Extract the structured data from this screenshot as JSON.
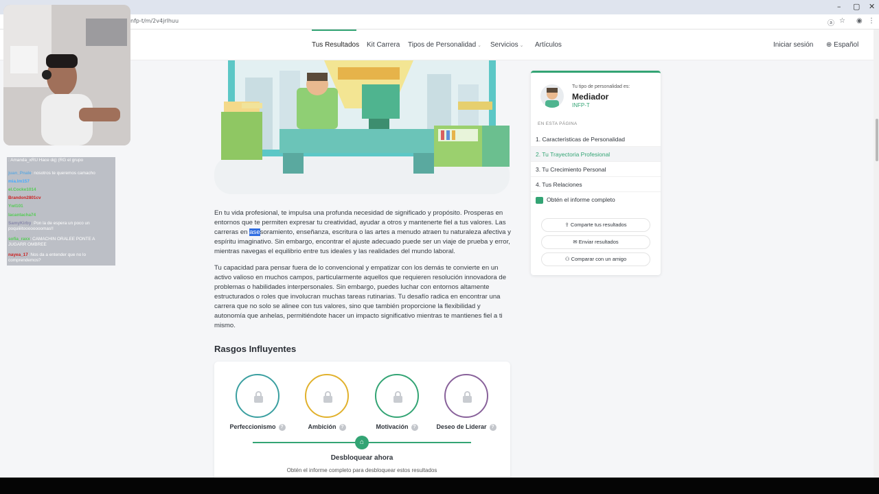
{
  "browser": {
    "url": "nfp-t/m/2v4jrlhuu",
    "window_controls": [
      "–",
      "▢",
      "✕"
    ]
  },
  "nav": {
    "items": [
      {
        "label": "Tus Resultados",
        "chevron": ""
      },
      {
        "label": "Kit Carrera",
        "chevron": ""
      },
      {
        "label": "Tipos de Personalidad",
        "chevron": "⌄"
      },
      {
        "label": "Servicios",
        "chevron": "⌄"
      },
      {
        "label": "Artículos",
        "chevron": ""
      }
    ],
    "login": "Iniciar sesión",
    "language": "Español"
  },
  "content": {
    "para1_a": "En tu vida profesional, te impulsa una profunda necesidad de significado y propósito. Prosperas en entornos que te permiten expresar tu creatividad, ayudar a otros y mantenerte fiel a tus valores. Las carreras en ",
    "para1_hl": "ase",
    "para1_b": "soramiento, enseñanza, escritura o las artes a menudo atraen tu naturaleza afectiva y espíritu imaginativo. Sin embargo, encontrar el ajuste adecuado puede ser un viaje de prueba y error, mientras navegas el equilibrio entre tus ideales y las realidades del mundo laboral.",
    "para2": "Tu capacidad para pensar fuera de lo convencional y empatizar con los demás te convierte en un activo valioso en muchos campos, particularmente aquellos que requieren resolución innovadora de problemas o habilidades interpersonales. Sin embargo, puedes luchar con entornos altamente estructurados o roles que involucran muchas tareas rutinarias. Tu desafío radica en encontrar una carrera que no solo se alinee con tus valores, sino que también proporcione la flexibilidad y autonomía que anhelas, permitiéndote hacer un impacto significativo mientras te mantienes fiel a ti mismo.",
    "section_title": "Rasgos Influyentes",
    "traits": [
      {
        "label": "Perfeccionismo",
        "color": "#3a9fa0"
      },
      {
        "label": "Ambición",
        "color": "#e1b12c"
      },
      {
        "label": "Motivación",
        "color": "#33a474"
      },
      {
        "label": "Deseo de Liderar",
        "color": "#88619a"
      }
    ],
    "unlock_title": "Desbloquear ahora",
    "unlock_text": "Obtén el informe completo para desbloquear estos resultados"
  },
  "sidebar": {
    "type_label": "Tu tipo de personalidad es:",
    "type_name": "Mediador",
    "type_code": "INFP-T",
    "section": "EN ESTA PÁGINA",
    "toc": [
      "1. Características de Personalidad",
      "2. Tu Trayectoria Profesional",
      "3. Tu Crecimiento Personal",
      "4. Tus Relaciones",
      "Obtén el informe completo"
    ],
    "buttons": [
      "Comparte tus resultados",
      "Enviar resultados",
      "Comparar con un amigo"
    ]
  },
  "chat": [
    {
      "user": "",
      "msg": ": Amanda_xRU Hace dq) (RG el grupo"
    },
    {
      "user": "juan_Pnale",
      "msg": ": nosotros te queremos camacho"
    },
    {
      "user": "mia.lm157",
      "msg": ""
    },
    {
      "user": "el.Cocke1014",
      "msg": ""
    },
    {
      "user": "Brandon2801cv",
      "msg": ""
    },
    {
      "user": "Ywl101",
      "msg": ""
    },
    {
      "user": "lacantacha74",
      "msg": ""
    },
    {
      "user": "SamyKirby",
      "msg": ": Pon la de espera un poco un poquiiiitoooooooomas!!"
    },
    {
      "user": "sofia_raxx",
      "msg": ": CAMACHIN ORALEE PONTE A JUGARR OMBREE"
    },
    {
      "user": "nayea_17",
      "msg": ": Nos da a entender que no lo comprendemos?"
    }
  ]
}
